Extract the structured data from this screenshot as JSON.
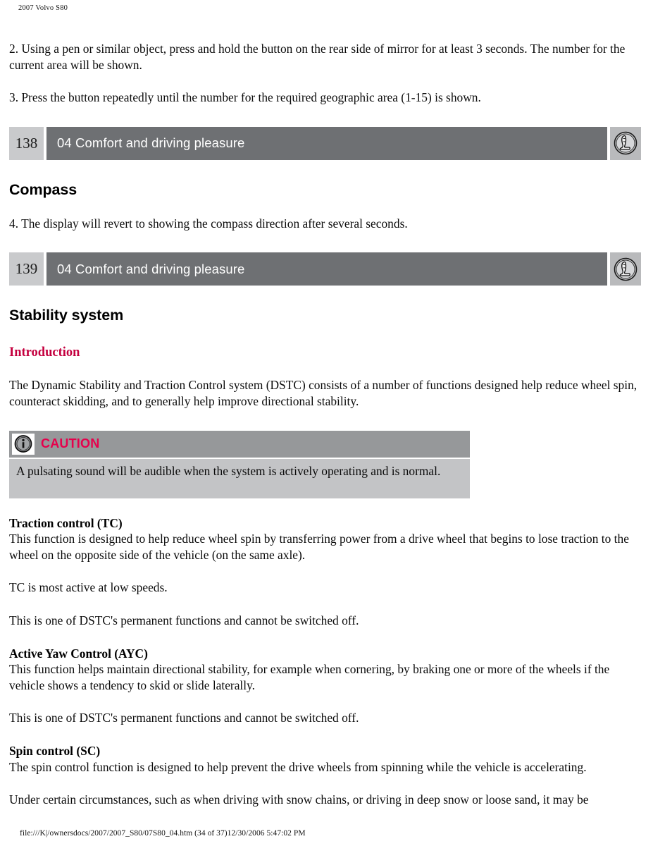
{
  "document": {
    "header": "2007 Volvo S80",
    "footer": "file:///K|/ownersdocs/2007/2007_S80/07S80_04.htm (34 of 37)12/30/2006 5:47:02 PM"
  },
  "colors": {
    "accent_red": "#c4003f",
    "caution_red": "#e6004c",
    "bar_dark_gray": "#6e7073",
    "bar_light_gray": "#c9cacc",
    "caution_head_gray": "#96989a",
    "caution_body_gray": "#c3c4c6",
    "icon_box_gray": "#b9babc"
  },
  "steps": {
    "step_two": "2. Using a pen or similar object, press and hold the button on the rear side of mirror for at least 3 seconds. The number for the current area will be shown.",
    "step_three": "3. Press the button repeatedly until the number for the required geographic area (1-15) is shown.",
    "step_four": "4. The display will revert to showing the compass direction after several seconds."
  },
  "page_bars": [
    {
      "page_number": "138",
      "section_title": "04 Comfort and driving pleasure",
      "icon": "car-seat-icon"
    },
    {
      "page_number": "139",
      "section_title": "04 Comfort and driving pleasure",
      "icon": "car-seat-icon"
    }
  ],
  "headings": {
    "compass": "Compass",
    "stability_system": "Stability system",
    "introduction": "Introduction"
  },
  "intro_paragraph": "The Dynamic Stability and Traction Control system (DSTC) consists of a number of functions designed help reduce wheel spin, counteract skidding, and to generally help improve directional stability.",
  "caution": {
    "icon": "info-icon",
    "label": "CAUTION",
    "text": "A pulsating sound will be audible when the system is actively operating and is normal."
  },
  "sections": [
    {
      "heading": "Traction control (TC)",
      "paragraph": "This function is designed to help reduce wheel spin by transferring power from a drive wheel that begins to lose traction to the wheel on the opposite side of the vehicle (on the same axle).",
      "extra_1": "TC is most active at low speeds.",
      "extra_2": "This is one of DSTC's permanent functions and cannot be switched off."
    },
    {
      "heading": "Active Yaw Control (AYC)",
      "paragraph": "This function helps maintain directional stability, for example when cornering, by braking one or more of the wheels if the vehicle shows a tendency to skid or slide laterally.",
      "extra_1": "This is one of DSTC's permanent functions and cannot be switched off."
    },
    {
      "heading": "Spin control (SC)",
      "paragraph": "The spin control function is designed to help prevent the drive wheels from spinning while the vehicle is accelerating.",
      "extra_1": "Under certain circumstances, such as when driving with snow chains, or driving in deep snow or loose sand, it may be"
    }
  ]
}
